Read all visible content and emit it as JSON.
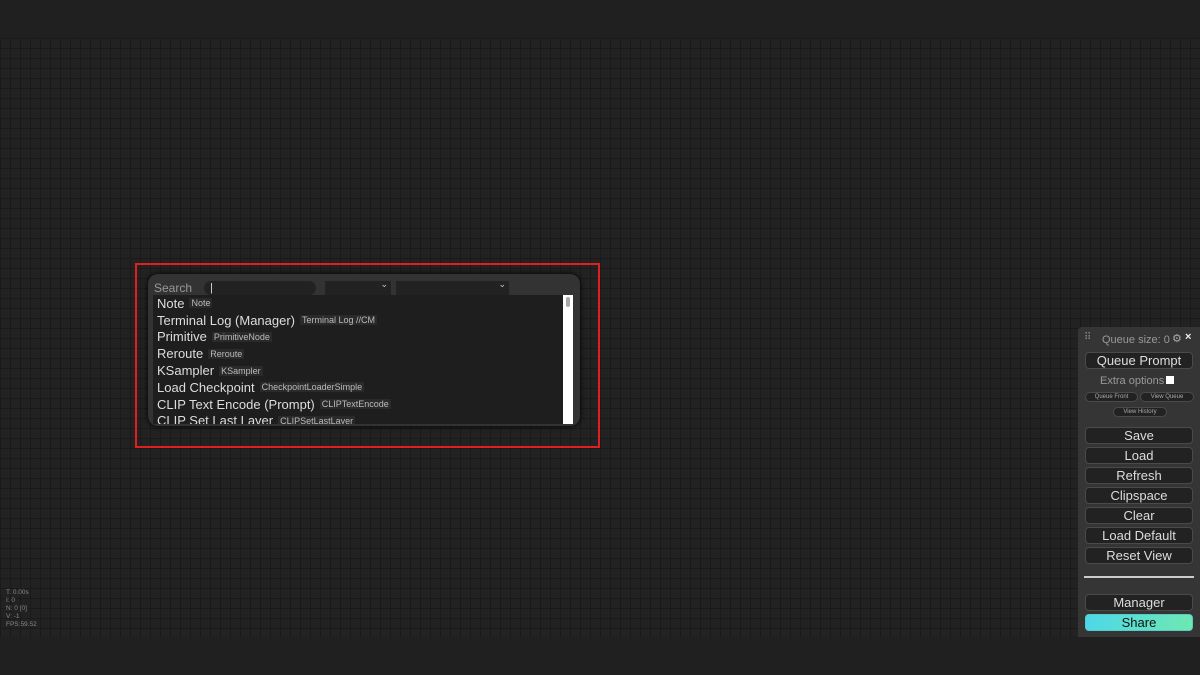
{
  "search": {
    "label": "Search",
    "value": "|",
    "filter1": "",
    "filter2": ""
  },
  "results": [
    {
      "name": "Note",
      "type": "Note"
    },
    {
      "name": "Terminal Log (Manager)",
      "type": "Terminal Log //CM"
    },
    {
      "name": "Primitive",
      "type": "PrimitiveNode"
    },
    {
      "name": "Reroute",
      "type": "Reroute"
    },
    {
      "name": "KSampler",
      "type": "KSampler"
    },
    {
      "name": "Load Checkpoint",
      "type": "CheckpointLoaderSimple"
    },
    {
      "name": "CLIP Text Encode (Prompt)",
      "type": "CLIPTextEncode"
    },
    {
      "name": "CLIP Set Last Layer",
      "type": "CLIPSetLastLayer"
    }
  ],
  "menu": {
    "queue_size": "Queue size: 0",
    "queue_prompt": "Queue Prompt",
    "extra_options": "Extra options",
    "queue_front": "Queue Front",
    "view_queue": "View Queue",
    "view_history": "View History",
    "buttons": [
      "Save",
      "Load",
      "Refresh",
      "Clipspace",
      "Clear",
      "Load Default",
      "Reset View"
    ],
    "manager": "Manager",
    "share": "Share"
  },
  "stats": [
    "T: 0.00s",
    "I: 0",
    "N: 0 [0]",
    "V: -1",
    "FPS:59.52"
  ],
  "colors": {
    "highlight": "#e02020",
    "share_gradient_start": "#4dd8e8",
    "share_gradient_end": "#6ee8b0"
  }
}
